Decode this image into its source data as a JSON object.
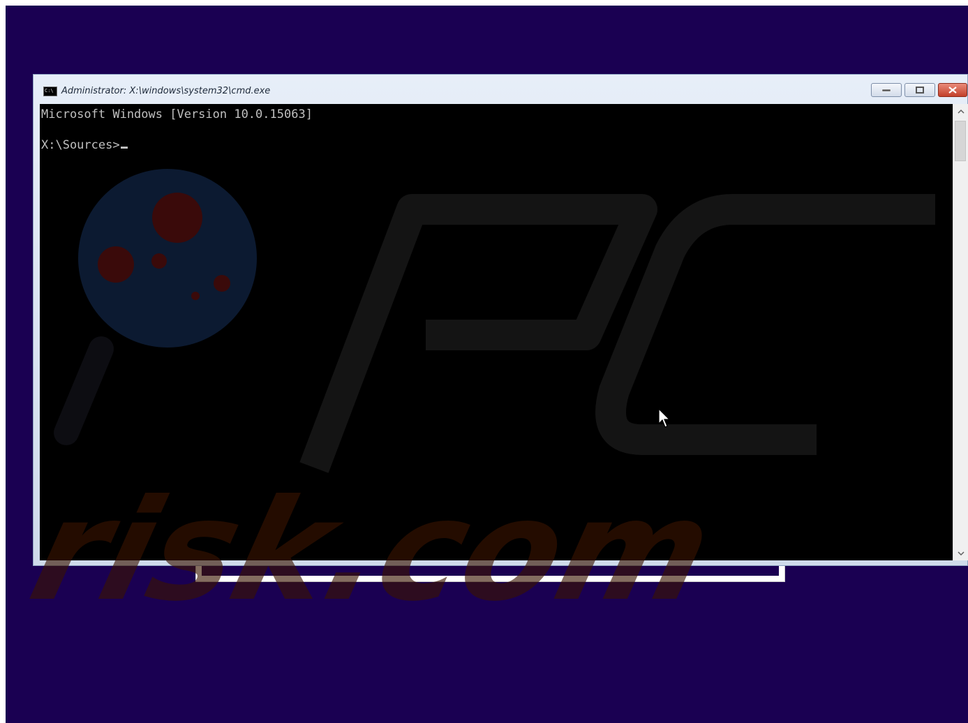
{
  "window": {
    "title": "Administrator: X:\\windows\\system32\\cmd.exe",
    "icon": "cmd-icon",
    "buttons": {
      "minimize_icon": "minimize-icon",
      "maximize_icon": "maximize-icon",
      "close_icon": "close-icon"
    }
  },
  "console": {
    "line1": "Microsoft Windows [Version 10.0.15063]",
    "line2": "",
    "prompt": "X:\\Sources>"
  },
  "scrollbar": {
    "up_arrow": "^",
    "down_arrow": "v"
  },
  "watermark": {
    "text": "risk.com",
    "logo": "pcrisk-logo"
  },
  "colors": {
    "setup_background": "#1a0052",
    "console_background": "#000000",
    "console_text": "#c0c0c0",
    "close_button": "#c3402a"
  }
}
